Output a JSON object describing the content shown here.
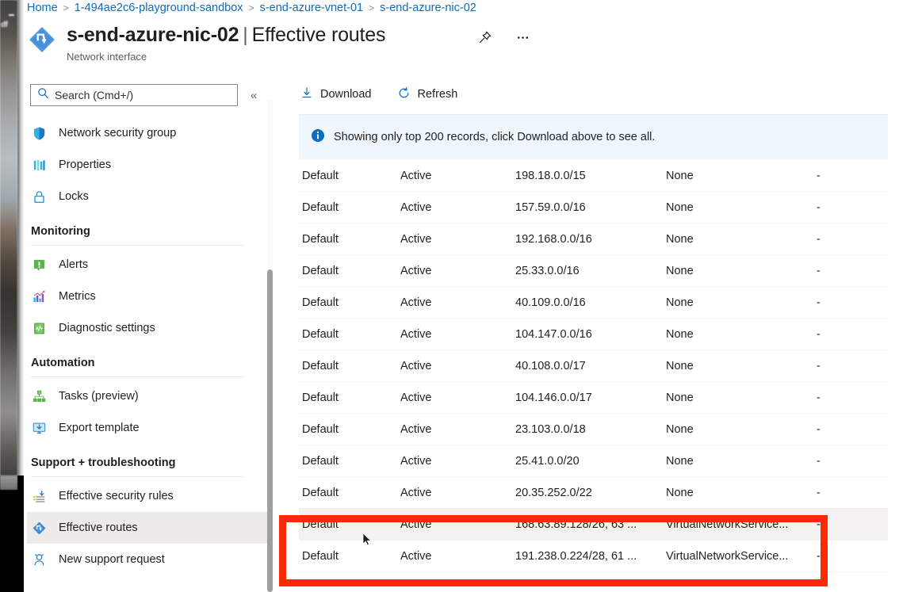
{
  "breadcrumb": {
    "items": [
      {
        "label": "Home",
        "link": true
      },
      {
        "label": "1-494ae2c6-playground-sandbox",
        "link": true
      },
      {
        "label": "s-end-azure-vnet-01",
        "link": true
      },
      {
        "label": "s-end-azure-nic-02",
        "link": true
      }
    ],
    "separator": ">"
  },
  "header": {
    "resource_name": "s-end-azure-nic-02",
    "separator": "|",
    "page_section": "Effective routes",
    "subtitle": "Network interface",
    "pin_icon": "pin-icon",
    "more_icon": "ellipsis-icon",
    "resource_icon": "network-interface-icon"
  },
  "sidebar": {
    "search": {
      "placeholder": "Search (Cmd+/)",
      "value": "",
      "icon": "search-icon"
    },
    "collapse": {
      "label": "«",
      "name": "collapse-menu-button"
    },
    "top_items": [
      {
        "label": "Network security group",
        "icon": "shield-icon",
        "selected": false
      },
      {
        "label": "Properties",
        "icon": "properties-icon",
        "selected": false
      },
      {
        "label": "Locks",
        "icon": "lock-icon",
        "selected": false
      }
    ],
    "groups": [
      {
        "title": "Monitoring",
        "items": [
          {
            "label": "Alerts",
            "icon": "alerts-icon",
            "selected": false
          },
          {
            "label": "Metrics",
            "icon": "metrics-chart-icon",
            "selected": false
          },
          {
            "label": "Diagnostic settings",
            "icon": "diagnostic-settings-icon",
            "selected": false
          }
        ]
      },
      {
        "title": "Automation",
        "items": [
          {
            "label": "Tasks (preview)",
            "icon": "tasks-icon",
            "selected": false
          },
          {
            "label": "Export template",
            "icon": "export-template-icon",
            "selected": false
          }
        ]
      },
      {
        "title": "Support + troubleshooting",
        "items": [
          {
            "label": "Effective security rules",
            "icon": "effective-security-rules-icon",
            "selected": false
          },
          {
            "label": "Effective routes",
            "icon": "effective-routes-icon",
            "selected": true
          },
          {
            "label": "New support request",
            "icon": "support-person-icon",
            "selected": false
          }
        ]
      }
    ]
  },
  "toolbar": {
    "download_label": "Download",
    "download_icon": "download-icon",
    "refresh_label": "Refresh",
    "refresh_icon": "refresh-icon"
  },
  "notification": {
    "icon": "info-icon",
    "message": "Showing only top 200 records, click Download above to see all."
  },
  "table": {
    "rows": [
      {
        "source": "Default",
        "state": "Active",
        "prefixes": "198.18.0.0/15",
        "next_hop_type": "None",
        "next_hop_ip": "-",
        "highlighted": false
      },
      {
        "source": "Default",
        "state": "Active",
        "prefixes": "157.59.0.0/16",
        "next_hop_type": "None",
        "next_hop_ip": "-",
        "highlighted": false
      },
      {
        "source": "Default",
        "state": "Active",
        "prefixes": "192.168.0.0/16",
        "next_hop_type": "None",
        "next_hop_ip": "-",
        "highlighted": false
      },
      {
        "source": "Default",
        "state": "Active",
        "prefixes": "25.33.0.0/16",
        "next_hop_type": "None",
        "next_hop_ip": "-",
        "highlighted": false
      },
      {
        "source": "Default",
        "state": "Active",
        "prefixes": "40.109.0.0/16",
        "next_hop_type": "None",
        "next_hop_ip": "-",
        "highlighted": false
      },
      {
        "source": "Default",
        "state": "Active",
        "prefixes": "104.147.0.0/16",
        "next_hop_type": "None",
        "next_hop_ip": "-",
        "highlighted": false
      },
      {
        "source": "Default",
        "state": "Active",
        "prefixes": "40.108.0.0/17",
        "next_hop_type": "None",
        "next_hop_ip": "-",
        "highlighted": false
      },
      {
        "source": "Default",
        "state": "Active",
        "prefixes": "104.146.0.0/17",
        "next_hop_type": "None",
        "next_hop_ip": "-",
        "highlighted": false
      },
      {
        "source": "Default",
        "state": "Active",
        "prefixes": "23.103.0.0/18",
        "next_hop_type": "None",
        "next_hop_ip": "-",
        "highlighted": false
      },
      {
        "source": "Default",
        "state": "Active",
        "prefixes": "25.41.0.0/20",
        "next_hop_type": "None",
        "next_hop_ip": "-",
        "highlighted": false
      },
      {
        "source": "Default",
        "state": "Active",
        "prefixes": "20.35.252.0/22",
        "next_hop_type": "None",
        "next_hop_ip": "-",
        "highlighted": false
      },
      {
        "source": "Default",
        "state": "Active",
        "prefixes": "168.63.89.128/26, 63 ...",
        "next_hop_type": "VirtualNetworkService...",
        "next_hop_ip": "-",
        "highlighted": true
      },
      {
        "source": "Default",
        "state": "Active",
        "prefixes": "191.238.0.224/28, 61 ...",
        "next_hop_type": "VirtualNetworkService...",
        "next_hop_ip": "-",
        "highlighted": false
      }
    ]
  },
  "annotation": {
    "highlight_color": "#fb2a04",
    "name": "red-highlight-box"
  },
  "colors": {
    "accent_blue": "#0f6cbd",
    "info_bg": "#eff6fc",
    "row_hover": "#f3f2f1",
    "nav_selected": "#edebe9"
  }
}
